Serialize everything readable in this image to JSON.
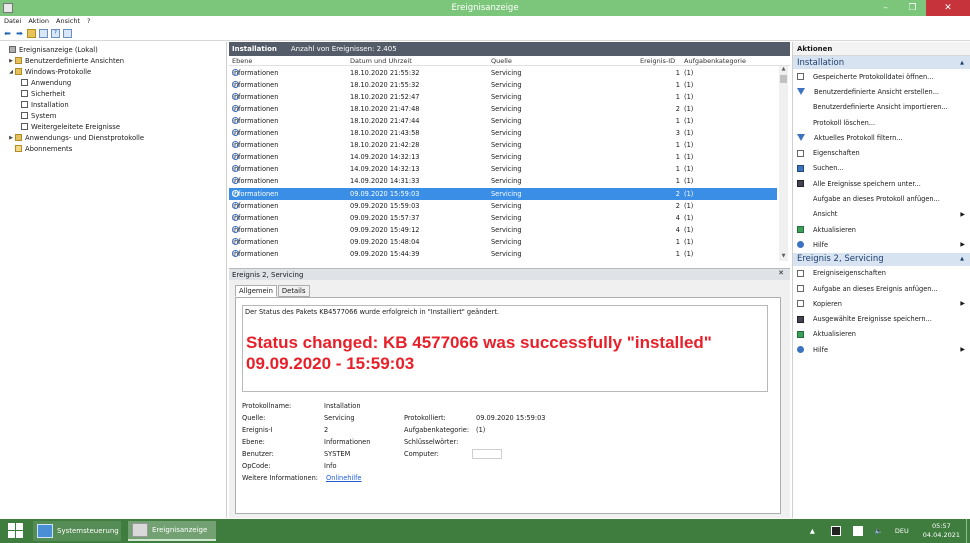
{
  "window": {
    "title": "Ereignisanzeige",
    "controls": [
      "–",
      "❐",
      "✕"
    ]
  },
  "menu": [
    "Datei",
    "Aktion",
    "Ansicht",
    "?"
  ],
  "tree": [
    {
      "label": "Ereignisanzeige (Lokal)",
      "level": 0,
      "expander": "",
      "icon": "ev"
    },
    {
      "label": "Benutzerdefinierte Ansichten",
      "level": 1,
      "expander": "▶",
      "icon": "folder"
    },
    {
      "label": "Windows-Protokolle",
      "level": 1,
      "expander": "◢",
      "icon": "folder"
    },
    {
      "label": "Anwendung",
      "level": 2,
      "expander": "",
      "icon": "log"
    },
    {
      "label": "Sicherheit",
      "level": 2,
      "expander": "",
      "icon": "log"
    },
    {
      "label": "Installation",
      "level": 2,
      "expander": "",
      "icon": "log"
    },
    {
      "label": "System",
      "level": 2,
      "expander": "",
      "icon": "log"
    },
    {
      "label": "Weitergeleitete Ereignisse",
      "level": 2,
      "expander": "",
      "icon": "log"
    },
    {
      "label": "Anwendungs- und Dienstprotokolle",
      "level": 1,
      "expander": "▶",
      "icon": "folder"
    },
    {
      "label": "Abonnements",
      "level": 1,
      "expander": "",
      "icon": "sub"
    }
  ],
  "list": {
    "title": "Installation",
    "count": "Anzahl von Ereignissen: 2.405",
    "columns": [
      "Ebene",
      "Datum und Uhrzeit",
      "Quelle",
      "Ereignis-ID",
      "Aufgabenkategorie"
    ],
    "rows": [
      {
        "level": "Informationen",
        "date": "18.10.2020 21:55:32",
        "source": "Servicing",
        "id": "1",
        "cat": "(1)"
      },
      {
        "level": "Informationen",
        "date": "18.10.2020 21:55:32",
        "source": "Servicing",
        "id": "1",
        "cat": "(1)"
      },
      {
        "level": "Informationen",
        "date": "18.10.2020 21:52:47",
        "source": "Servicing",
        "id": "1",
        "cat": "(1)"
      },
      {
        "level": "Informationen",
        "date": "18.10.2020 21:47:48",
        "source": "Servicing",
        "id": "2",
        "cat": "(1)"
      },
      {
        "level": "Informationen",
        "date": "18.10.2020 21:47:44",
        "source": "Servicing",
        "id": "1",
        "cat": "(1)"
      },
      {
        "level": "Informationen",
        "date": "18.10.2020 21:43:58",
        "source": "Servicing",
        "id": "3",
        "cat": "(1)"
      },
      {
        "level": "Informationen",
        "date": "18.10.2020 21:42:28",
        "source": "Servicing",
        "id": "1",
        "cat": "(1)"
      },
      {
        "level": "Informationen",
        "date": "14.09.2020 14:32:13",
        "source": "Servicing",
        "id": "1",
        "cat": "(1)"
      },
      {
        "level": "Informationen",
        "date": "14.09.2020 14:32:13",
        "source": "Servicing",
        "id": "1",
        "cat": "(1)"
      },
      {
        "level": "Informationen",
        "date": "14.09.2020 14:31:33",
        "source": "Servicing",
        "id": "1",
        "cat": "(1)"
      },
      {
        "level": "Informationen",
        "date": "09.09.2020 15:59:03",
        "source": "Servicing",
        "id": "2",
        "cat": "(1)"
      },
      {
        "level": "Informationen",
        "date": "09.09.2020 15:59:03",
        "source": "Servicing",
        "id": "2",
        "cat": "(1)"
      },
      {
        "level": "Informationen",
        "date": "09.09.2020 15:57:37",
        "source": "Servicing",
        "id": "4",
        "cat": "(1)"
      },
      {
        "level": "Informationen",
        "date": "09.09.2020 15:49:12",
        "source": "Servicing",
        "id": "4",
        "cat": "(1)"
      },
      {
        "level": "Informationen",
        "date": "09.09.2020 15:48:04",
        "source": "Servicing",
        "id": "1",
        "cat": "(1)"
      },
      {
        "level": "Informationen",
        "date": "09.09.2020 15:44:39",
        "source": "Servicing",
        "id": "1",
        "cat": "(1)"
      }
    ],
    "selected_index": 10
  },
  "detail": {
    "header": "Ereignis 2, Servicing",
    "tabs": [
      "Allgemein",
      "Details"
    ],
    "message": "Der Status des Pakets KB4577066 wurde erfolgreich in \"Installiert\" geändert.",
    "overlay_line1": "Status changed: KB 4577066 was successfully \"installed\"",
    "overlay_line2": "09.09.2020 - 15:59:03",
    "props": {
      "protokollname_label": "Protokollname:",
      "protokollname": "Installation",
      "quelle_label": "Quelle:",
      "quelle": "Servicing",
      "ereignis_label": "Ereignis-I",
      "ereignis": "2",
      "ebene_label": "Ebene:",
      "ebene": "Informationen",
      "benutzer_label": "Benutzer:",
      "benutzer": "SYSTEM",
      "opcode_label": "OpCode:",
      "opcode": "Info",
      "weitere_label": "Weitere Informationen:",
      "weitere_link": "Onlinehilfe",
      "protokolliert_label": "Protokolliert:",
      "protokolliert": "09.09.2020 15:59:03",
      "aufgabe_label": "Aufgabenkategorie:",
      "aufgabe": "(1)",
      "schluessel_label": "Schlüsselwörter:",
      "computer_label": "Computer:"
    }
  },
  "actions": {
    "title": "Aktionen",
    "section1": "Installation",
    "items1": [
      {
        "label": "Gespeicherte Protokolldatei öffnen...",
        "icon": "doc",
        "sub": ""
      },
      {
        "label": "Benutzerdefinierte Ansicht erstellen...",
        "icon": "filter",
        "sub": ""
      },
      {
        "label": "Benutzerdefinierte Ansicht importieren...",
        "icon": "",
        "sub": ""
      },
      {
        "label": "Protokoll löschen...",
        "icon": "",
        "sub": ""
      },
      {
        "label": "Aktuelles Protokoll filtern...",
        "icon": "filter",
        "sub": ""
      },
      {
        "label": "Eigenschaften",
        "icon": "doc",
        "sub": ""
      },
      {
        "label": "Suchen...",
        "icon": "blue",
        "sub": ""
      },
      {
        "label": "Alle Ereignisse speichern unter...",
        "icon": "disk",
        "sub": ""
      },
      {
        "label": "Aufgabe an dieses Protokoll anfügen...",
        "icon": "",
        "sub": ""
      },
      {
        "label": "Ansicht",
        "icon": "",
        "sub": "▶"
      },
      {
        "label": "Aktualisieren",
        "icon": "green",
        "sub": ""
      },
      {
        "label": "Hilfe",
        "icon": "help",
        "sub": "▶"
      }
    ],
    "section2": "Ereignis 2, Servicing",
    "items2": [
      {
        "label": "Ereigniseigenschaften",
        "icon": "doc",
        "sub": ""
      },
      {
        "label": "Aufgabe an dieses Ereignis anfügen...",
        "icon": "doc",
        "sub": ""
      },
      {
        "label": "Kopieren",
        "icon": "doc",
        "sub": "▶"
      },
      {
        "label": "Ausgewählte Ereignisse speichern...",
        "icon": "disk",
        "sub": ""
      },
      {
        "label": "Aktualisieren",
        "icon": "green",
        "sub": ""
      },
      {
        "label": "Hilfe",
        "icon": "help",
        "sub": "▶"
      }
    ]
  },
  "taskbar": {
    "task1": "Systemsteuerung",
    "task2": "Ereignisanzeige",
    "lang": "DEU",
    "time": "05:57",
    "date": "04.04.2021"
  }
}
